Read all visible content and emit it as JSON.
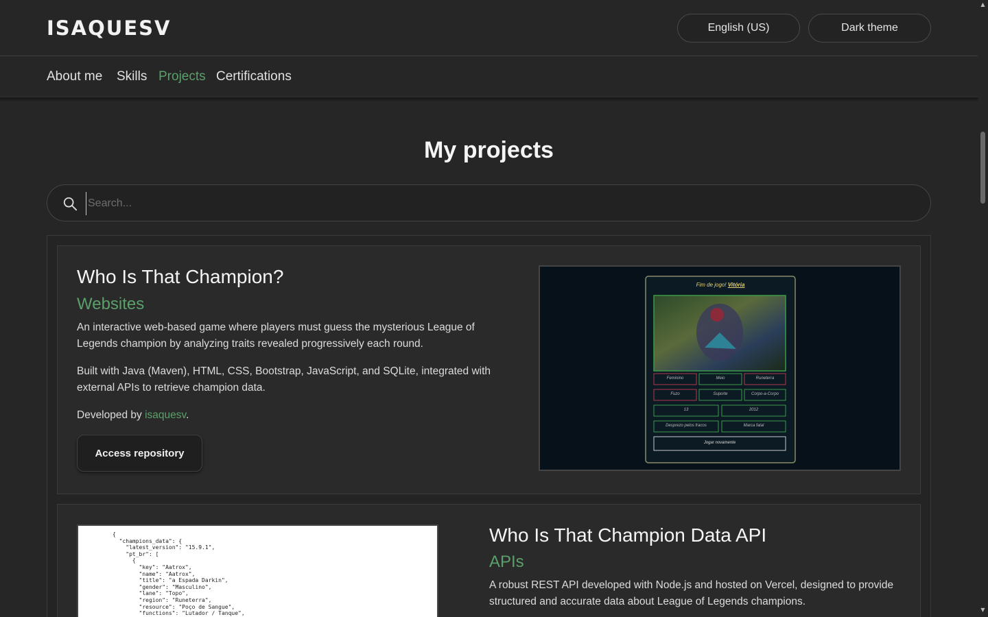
{
  "header": {
    "logo": "ISAQUESV",
    "language_button": "English (US)",
    "theme_button": "Dark theme"
  },
  "nav": {
    "items": [
      {
        "label": "About me",
        "active": false
      },
      {
        "label": "Skills",
        "active": false
      },
      {
        "label": "Projects",
        "active": true
      },
      {
        "label": "Certifications",
        "active": false
      }
    ]
  },
  "main": {
    "title": "My projects",
    "search": {
      "placeholder": "Search...",
      "value": ""
    }
  },
  "projects": [
    {
      "title": "Who Is That Champion?",
      "category": "Websites",
      "description": "An interactive web-based game where players must guess the mysterious League of Legends champion by analyzing traits revealed progressively each round.",
      "tech": "Built with Java (Maven), HTML, CSS, Bootstrap, JavaScript, and SQLite, integrated with external APIs to retrieve champion data.",
      "developed_by_prefix": "Developed by ",
      "developer": "isaquesv",
      "developed_by_suffix": ".",
      "button": "Access repository",
      "screenshot": {
        "heading_prefix": "Fim de jogo!",
        "heading_result": "Vitória",
        "tiles_row1": [
          "Feminino",
          "Meio",
          "Runeterra"
        ],
        "tiles_row2": [
          "Fuzo",
          "Suporte",
          "Corpo-a-Corpo"
        ],
        "tiles_row3": [
          "13",
          "2012"
        ],
        "tiles_row4": [
          "Desprezo pelos fracos",
          "Marca fatal"
        ],
        "play_again": "Jogar novamente"
      }
    },
    {
      "title": "Who Is That Champion Data API",
      "category": "APIs",
      "description": "A robust REST API developed with Node.js and hosted on Vercel, designed to provide structured and accurate data about League of Legends champions.",
      "code": "{\n  \"champions_data\": {\n    \"latest_version\": \"15.9.1\",\n    \"pt_br\": [\n      {\n        \"key\": \"Aatrox\",\n        \"name\": \"Aatrox\",\n        \"title\": \"a Espada Darkin\",\n        \"gender\": \"Masculino\",\n        \"lane\": \"Topo\",\n        \"region\": \"Runeterra\",\n        \"resource\": \"Poço de Sangue\",\n        \"functions\": \"Lutador / Tanque\","
    }
  ],
  "colors": {
    "accent": "#5aa06a",
    "background": "#262626",
    "card": "#2a2a2a"
  }
}
